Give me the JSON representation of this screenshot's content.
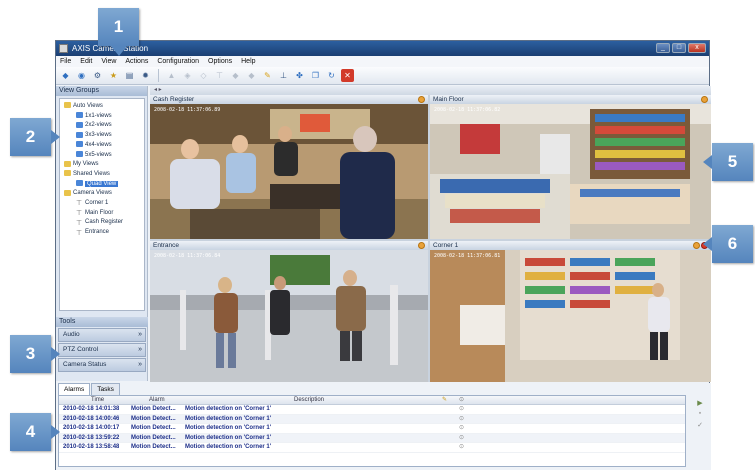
{
  "window": {
    "title": "AXIS Camera Station",
    "buttons": {
      "minimize": "_",
      "maximize": "□",
      "close": "x"
    }
  },
  "menu": [
    "File",
    "Edit",
    "View",
    "Actions",
    "Configuration",
    "Options",
    "Help"
  ],
  "toolbar_icons": [
    "live-view-icon",
    "monitor-icon",
    "settings-icon",
    "bookmark-icon",
    "clipboard-icon",
    "gear-icon",
    "ptz-icon",
    "ptz-icon-2",
    "ptz-icon-3",
    "ptz-icon-4",
    "ptz-icon-5",
    "ptz-icon-6",
    "pencil-icon",
    "antenna-icon",
    "network-icon",
    "export-icon",
    "refresh-icon",
    "close-red-icon"
  ],
  "view_groups": {
    "header": "View Groups",
    "tree": [
      {
        "label": "Auto Views",
        "type": "folder",
        "level": 0
      },
      {
        "label": "1x1-views",
        "type": "grid",
        "level": 1
      },
      {
        "label": "2x2-views",
        "type": "grid",
        "level": 1
      },
      {
        "label": "3x3-views",
        "type": "grid",
        "level": 1
      },
      {
        "label": "4x4-views",
        "type": "grid",
        "level": 1
      },
      {
        "label": "5x5-views",
        "type": "grid",
        "level": 1
      },
      {
        "label": "My Views",
        "type": "folder",
        "level": 0
      },
      {
        "label": "Shared Views",
        "type": "folder",
        "level": 0
      },
      {
        "label": "Quad View",
        "type": "grid",
        "level": 1,
        "selected": true
      },
      {
        "label": "Camera Views",
        "type": "folder",
        "level": 0
      },
      {
        "label": "Corner 1",
        "type": "cam",
        "level": 1
      },
      {
        "label": "Main Floor",
        "type": "cam",
        "level": 1
      },
      {
        "label": "Cash Register",
        "type": "cam",
        "level": 1
      },
      {
        "label": "Entrance",
        "type": "cam",
        "level": 1
      }
    ]
  },
  "tools": {
    "header": "Tools",
    "items": [
      "Audio",
      "PTZ Control",
      "Camera Status"
    ]
  },
  "cameras": [
    {
      "name": "Cash Register",
      "timestamp": "2008-02-18 11:37:06.89"
    },
    {
      "name": "Main Floor",
      "timestamp": "2008-02-18 11:37:06.82"
    },
    {
      "name": "Entrance",
      "timestamp": "2008-02-18 11:37:06.84"
    },
    {
      "name": "Corner 1",
      "timestamp": "2008-02-18 11:37:06.81"
    }
  ],
  "bottom_tabs": [
    "Alarms",
    "Tasks"
  ],
  "alarms": {
    "columns": [
      "Time",
      "Alarm",
      "Description"
    ],
    "rows": [
      {
        "time": "2010-02-18 14:01:38",
        "alarm": "Motion Detect...",
        "description": "Motion detection on 'Corner 1'"
      },
      {
        "time": "2010-02-18 14:00:46",
        "alarm": "Motion Detect...",
        "description": "Motion detection on 'Corner 1'"
      },
      {
        "time": "2010-02-18 14:00:17",
        "alarm": "Motion Detect...",
        "description": "Motion detection on 'Corner 1'"
      },
      {
        "time": "2010-02-18 13:59:22",
        "alarm": "Motion Detect...",
        "description": "Motion detection on 'Corner 1'"
      },
      {
        "time": "2010-02-18 13:58:48",
        "alarm": "Motion Detect...",
        "description": "Motion detection on 'Corner 1'"
      }
    ]
  },
  "callouts": [
    "1",
    "2",
    "3",
    "4",
    "5",
    "6"
  ],
  "colors": {
    "callout": "#5585bd",
    "accent": "#3a78d2",
    "alarm_text": "#1d2f8a"
  }
}
